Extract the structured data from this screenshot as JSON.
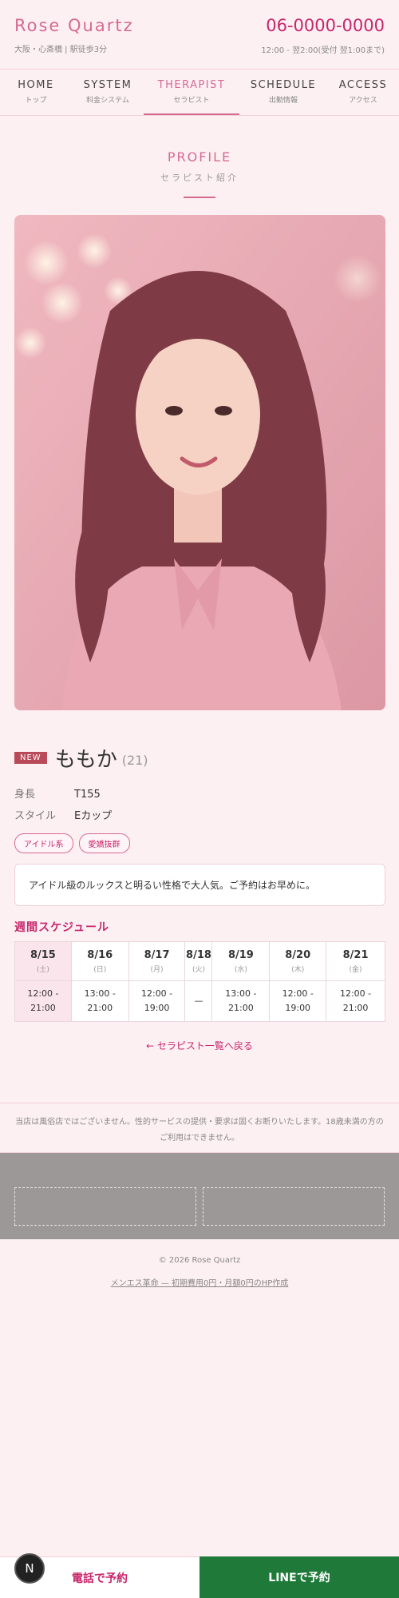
{
  "header": {
    "brand": "Rose Quartz",
    "location": "大阪・心斎橋 | 駅徒歩3分",
    "phone": "06-0000-0000",
    "hours": "12:00 - 翌2:00(受付 翌1:00まで)"
  },
  "nav": [
    {
      "en": "HOME",
      "ja": "トップ"
    },
    {
      "en": "SYSTEM",
      "ja": "料金システム"
    },
    {
      "en": "THERAPIST",
      "ja": "セラピスト"
    },
    {
      "en": "SCHEDULE",
      "ja": "出勤情報"
    },
    {
      "en": "ACCESS",
      "ja": "アクセス"
    }
  ],
  "section": {
    "en": "PROFILE",
    "ja": "セラピスト紹介"
  },
  "profile": {
    "badge": "NEW",
    "name": "ももか",
    "age": "(21)",
    "specs": [
      {
        "label": "身長",
        "value": "T155"
      },
      {
        "label": "スタイル",
        "value": "Eカップ"
      }
    ],
    "tags": [
      "アイドル系",
      "愛嬌抜群"
    ],
    "comment": "アイドル級のルックスと明るい性格で大人気。ご予約はお早めに。"
  },
  "schedule": {
    "title": "週間スケジュール",
    "days": [
      {
        "date": "8/15",
        "weekday": "(土)",
        "start": "12:00 -",
        "end": "21:00"
      },
      {
        "date": "8/16",
        "weekday": "(日)",
        "start": "13:00 -",
        "end": "21:00"
      },
      {
        "date": "8/17",
        "weekday": "(月)",
        "start": "12:00 -",
        "end": "19:00"
      },
      {
        "date": "8/18",
        "weekday": "(火)",
        "start": "—",
        "end": ""
      },
      {
        "date": "8/19",
        "weekday": "(水)",
        "start": "13:00 -",
        "end": "21:00"
      },
      {
        "date": "8/20",
        "weekday": "(木)",
        "start": "12:00 -",
        "end": "19:00"
      },
      {
        "date": "8/21",
        "weekday": "(金)",
        "start": "12:00 -",
        "end": "21:00"
      }
    ]
  },
  "back_link": "← セラピスト一覧へ戻る",
  "disclaimer": "当店は風俗店ではございません。性的サービスの提供・要求は固くお断りいたします。18歳未満の方のご利用はできません。",
  "footer": {
    "copyright": "© 2026 Rose Quartz",
    "credit": "メンエス革命 — 初期費用0円・月額0円のHP作成"
  },
  "bottom": {
    "call": "電話で予約",
    "line": "LINEで予約",
    "badge": "N"
  },
  "colors": {
    "accent": "#d66a91",
    "accent_dark": "#c8266b",
    "line_green": "#1f7a3a",
    "background": "#fdf0f3"
  }
}
